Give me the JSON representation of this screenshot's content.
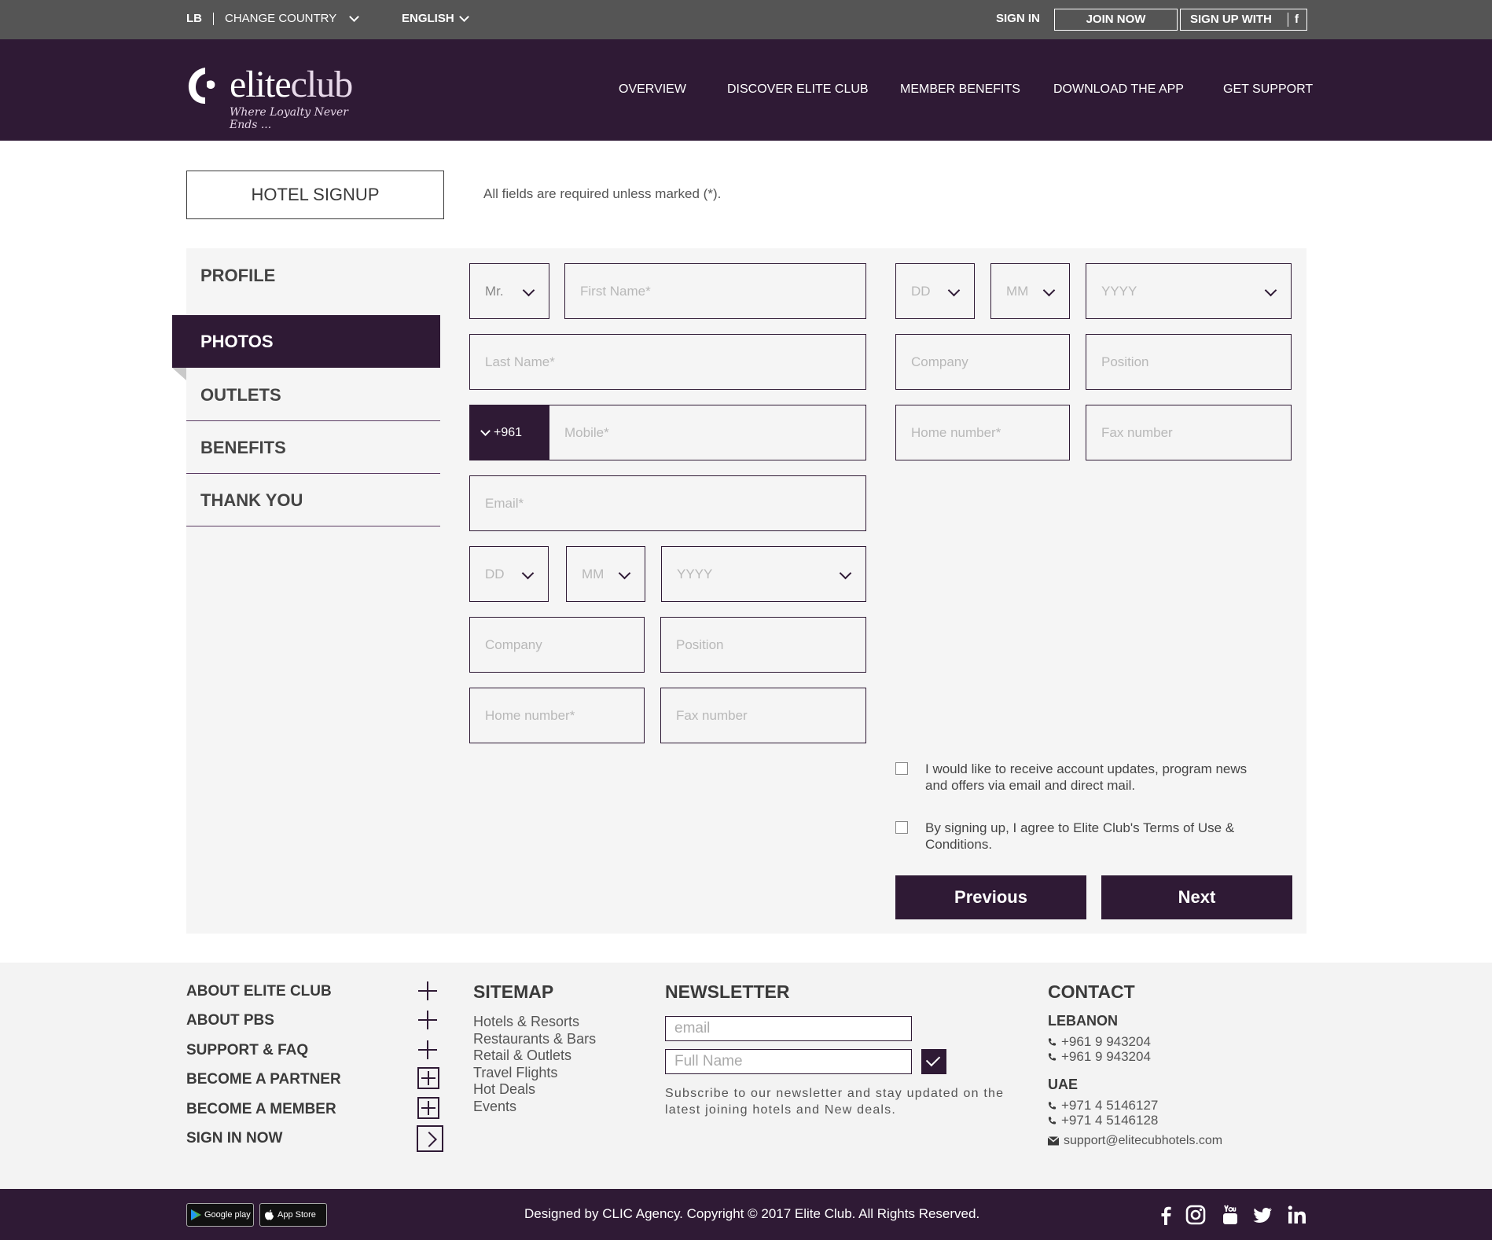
{
  "topbar": {
    "country_code": "LB",
    "change_country": "CHANGE COUNTRY",
    "language": "ENGLISH",
    "sign_in": "SIGN IN",
    "join_now": "JOIN NOW",
    "sign_up_with": "SIGN UP WITH",
    "facebook_glyph": "f"
  },
  "header": {
    "logo_elite": "elite",
    "logo_club": "club",
    "tagline": "Where Loyalty Never Ends ...",
    "nav": [
      "OVERVIEW",
      "DISCOVER ELITE CLUB",
      "MEMBER BENEFITS",
      "DOWNLOAD THE APP",
      "GET SUPPORT"
    ]
  },
  "page": {
    "title": "HOTEL SIGNUP",
    "required_note": "All fields are required unless marked (*)."
  },
  "steps": [
    {
      "label": "PROFILE",
      "active": false
    },
    {
      "label": "PHOTOS",
      "active": true
    },
    {
      "label": "OUTLETS",
      "active": false
    },
    {
      "label": "BENEFITS",
      "active": false
    },
    {
      "label": "THANK YOU",
      "active": false
    }
  ],
  "form_left": {
    "title_value": "Mr.",
    "first_name_placeholder": "First Name*",
    "last_name_placeholder": "Last Name*",
    "mobile_prefix": "+961",
    "mobile_placeholder": "Mobile*",
    "email_placeholder": "Email*",
    "dob_day": "DD",
    "dob_month": "MM",
    "dob_year": "YYYY",
    "company_placeholder": "Company",
    "position_placeholder": "Position",
    "home_number_placeholder": "Home number*",
    "fax_number_placeholder": "Fax number"
  },
  "form_right": {
    "dob_day": "DD",
    "dob_month": "MM",
    "dob_year": "YYYY",
    "company_placeholder": "Company",
    "position_placeholder": "Position",
    "home_number_placeholder": "Home number*",
    "fax_number_placeholder": "Fax number",
    "consent_updates": "I would like to receive account updates, program news and offers via email and direct mail.",
    "consent_terms": "By signing up, I agree to Elite Club's Terms of Use & Conditions.",
    "consent_updates_checked": false,
    "consent_terms_checked": false,
    "previous_label": "Previous",
    "next_label": "Next"
  },
  "footer": {
    "about_links": [
      "ABOUT ELITE CLUB",
      "ABOUT PBS",
      "SUPPORT & FAQ",
      "BECOME A PARTNER",
      "BECOME A MEMBER",
      "SIGN IN NOW"
    ],
    "sitemap_title": "SITEMAP",
    "sitemap_links": [
      "Hotels & Resorts",
      "Restaurants & Bars",
      "Retail & Outlets",
      "Travel Flights",
      "Hot Deals",
      "Events"
    ],
    "newsletter_title": "NEWSLETTER",
    "newsletter_email_placeholder": "email",
    "newsletter_name_placeholder": "Full Name",
    "newsletter_desc": "Subscribe to our newsletter and stay updated on the latest joining hotels and New deals.",
    "contact_title": "CONTACT",
    "lebanon_label": "LEBANON",
    "lebanon_phones": [
      "+961 9 943204",
      "+961 9 943204"
    ],
    "uae_label": "UAE",
    "uae_phones": [
      "+971 4 5146127",
      "+971 4 5146128"
    ],
    "email": "support@elitecubhotels.com"
  },
  "bottombar": {
    "google_play": "Google play",
    "app_store": "App Store",
    "copyright": "Designed by CLIC Agency. Copyright © 2017 Elite Club. All Rights Reserved.",
    "social_icons": [
      "facebook-icon",
      "instagram-icon",
      "youtube-icon",
      "twitter-icon",
      "linkedin-icon"
    ]
  },
  "colors": {
    "brand_purple": "#2f1a35",
    "topbar_gray": "#555555",
    "panel_bg": "#f5f5f5"
  }
}
